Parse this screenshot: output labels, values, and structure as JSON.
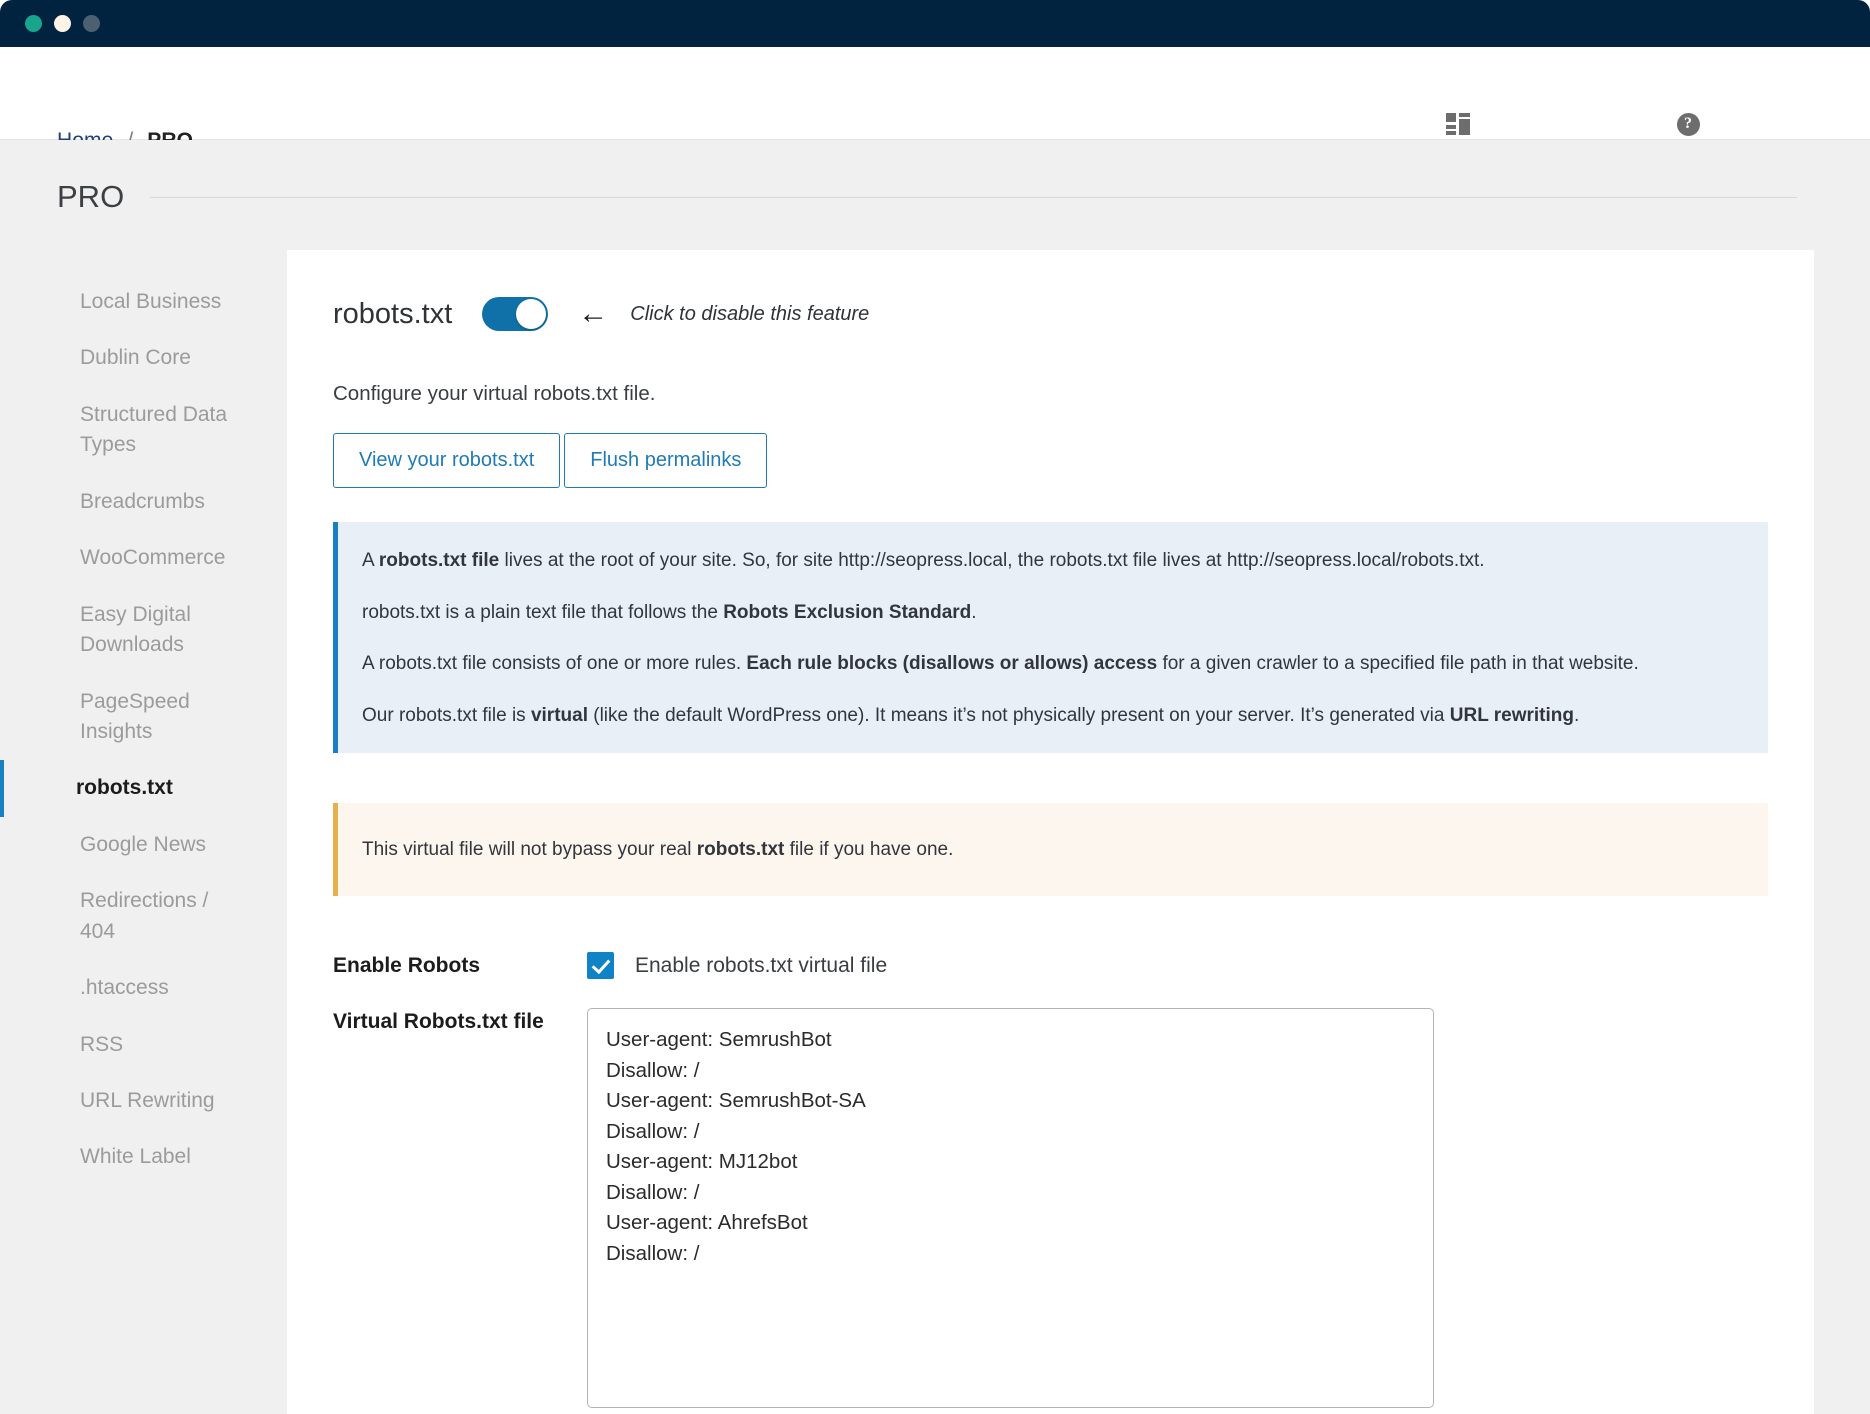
{
  "window": {
    "traffic_lights": [
      "close-green",
      "minimize-cream",
      "maximize-slate"
    ]
  },
  "adminbar": {
    "breadcrumb": {
      "home": "Home",
      "separator": "/",
      "current": "PRO"
    },
    "actions": [
      {
        "label": "Display",
        "icon": "layout-display-icon"
      },
      {
        "label": "Documentation",
        "icon": "question-circle-icon"
      }
    ]
  },
  "page": {
    "title": "PRO"
  },
  "sidebar": {
    "items": [
      {
        "label": "Local Business",
        "active": false
      },
      {
        "label": "Dublin Core",
        "active": false
      },
      {
        "label": "Structured Data Types",
        "active": false
      },
      {
        "label": "Breadcrumbs",
        "active": false
      },
      {
        "label": "WooCommerce",
        "active": false
      },
      {
        "label": "Easy Digital Downloads",
        "active": false
      },
      {
        "label": "PageSpeed Insights",
        "active": false
      },
      {
        "label": "robots.txt",
        "active": true
      },
      {
        "label": "Google News",
        "active": false
      },
      {
        "label": "Redirections / 404",
        "active": false
      },
      {
        "label": ".htaccess",
        "active": false
      },
      {
        "label": "RSS",
        "active": false
      },
      {
        "label": "URL Rewriting",
        "active": false
      },
      {
        "label": "White Label",
        "active": false
      }
    ]
  },
  "feature": {
    "title": "robots.txt",
    "toggle_state": "on",
    "toggle_hint": "Click to disable this feature",
    "arrow_glyph": "←",
    "description": "Configure your virtual robots.txt file.",
    "buttons": [
      {
        "label": "View your robots.txt"
      },
      {
        "label": "Flush permalinks"
      }
    ]
  },
  "info_notice": {
    "paragraphs": [
      [
        {
          "t": "A ",
          "b": false
        },
        {
          "t": "robots.txt file",
          "b": true
        },
        {
          "t": " lives at the root of your site. So, for site http://seopress.local, the robots.txt file lives at http://seopress.local/robots.txt.",
          "b": false
        }
      ],
      [
        {
          "t": "robots.txt is a plain text file that follows the ",
          "b": false
        },
        {
          "t": "Robots Exclusion Standard",
          "b": true
        },
        {
          "t": ".",
          "b": false
        }
      ],
      [
        {
          "t": "A robots.txt file consists of one or more rules. ",
          "b": false
        },
        {
          "t": "Each rule blocks (disallows or allows) access",
          "b": true
        },
        {
          "t": " for a given crawler to a specified file path in that website.",
          "b": false
        }
      ],
      [
        {
          "t": "Our robots.txt file is ",
          "b": false
        },
        {
          "t": "virtual",
          "b": true
        },
        {
          "t": " (like the default WordPress one). It means it’s not physically present on your server. It’s generated via ",
          "b": false
        },
        {
          "t": "URL rewriting",
          "b": true
        },
        {
          "t": ".",
          "b": false
        }
      ]
    ]
  },
  "warning_notice": {
    "paragraphs": [
      [
        {
          "t": "This virtual file will not bypass your real ",
          "b": false
        },
        {
          "t": "robots.txt",
          "b": true
        },
        {
          "t": " file if you have one.",
          "b": false
        }
      ]
    ]
  },
  "enable_robots": {
    "label": "Enable Robots",
    "checkbox_label": "Enable robots.txt virtual file",
    "checked": true
  },
  "virtual_file": {
    "label": "Virtual Robots.txt file",
    "value": "User-agent: SemrushBot\nDisallow: /\nUser-agent: SemrushBot-SA\nDisallow: /\nUser-agent: MJ12bot\nDisallow: /\nUser-agent: AhrefsBot\nDisallow: /",
    "placeholder": ""
  },
  "colors": {
    "titlebar": "#022340",
    "accent_blue": "#1a7fc1",
    "link_blue": "#1f7bb6",
    "info_bg": "#e8eff7",
    "info_border": "#1a7fc1",
    "warn_bg": "#fdf6ee",
    "warn_border": "#e6b14c",
    "page_bg": "#f0f0f0",
    "toggle_on": "#1070a8",
    "checkbox": "#1083c7"
  }
}
